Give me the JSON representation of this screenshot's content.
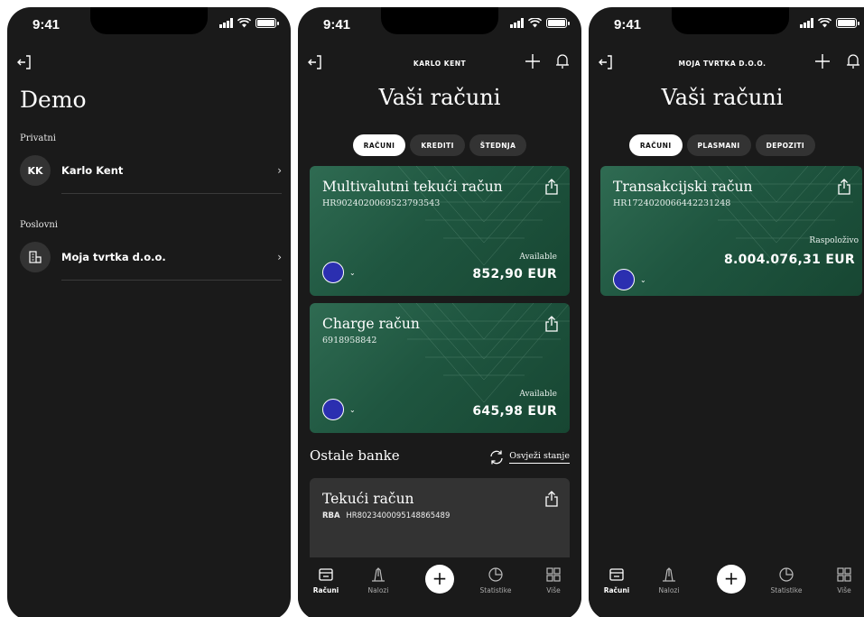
{
  "status_time": "9:41",
  "screen1": {
    "title": "Demo",
    "private_label": "Privatni",
    "private_user": {
      "initials": "KK",
      "name": "Karlo Kent",
      "chevron": "›"
    },
    "business_label": "Poslovni",
    "business_user": {
      "name": "Moja tvrtka d.o.o.",
      "chevron": "›"
    }
  },
  "screen2": {
    "header_name": "KARLO KENT",
    "title": "Vaši računi",
    "tabs": [
      "RAČUNI",
      "KREDITI",
      "ŠTEDNJA"
    ],
    "active_tab": "RAČUNI",
    "cards": [
      {
        "name": "Multivalutni tekući račun",
        "number": "HR9024020069523793543",
        "available_label": "Available",
        "balance": "852,90 EUR"
      },
      {
        "name": "Charge račun",
        "number": "6918958842",
        "available_label": "Available",
        "balance": "645,98 EUR"
      }
    ],
    "other_banks_title": "Ostale banke",
    "refresh_label": "Osvježi stanje",
    "other_bank_card": {
      "name": "Tekući račun",
      "bank_code": "RBA",
      "number": "HR8023400095148865489"
    }
  },
  "screen3": {
    "header_name": "MOJA TVRTKA D.O.O.",
    "title": "Vaši računi",
    "tabs": [
      "RAČUNI",
      "PLASMANI",
      "DEPOZITI"
    ],
    "active_tab": "RAČUNI",
    "cards": [
      {
        "name": "Transakcijski račun",
        "number": "HR1724020066442231248",
        "available_label": "Raspoloživo",
        "balance": "8.004.076,31 EUR"
      }
    ]
  },
  "tabbar": {
    "items": [
      "Računi",
      "Nalozi",
      "Statistike",
      "Više"
    ],
    "fab": "+",
    "active": "Računi"
  },
  "icons": {
    "card_chevron": "⌄",
    "card_gradient": [
      "#2f6b52",
      "#174632"
    ],
    "eu_flag_color": "#2b2fb0"
  }
}
